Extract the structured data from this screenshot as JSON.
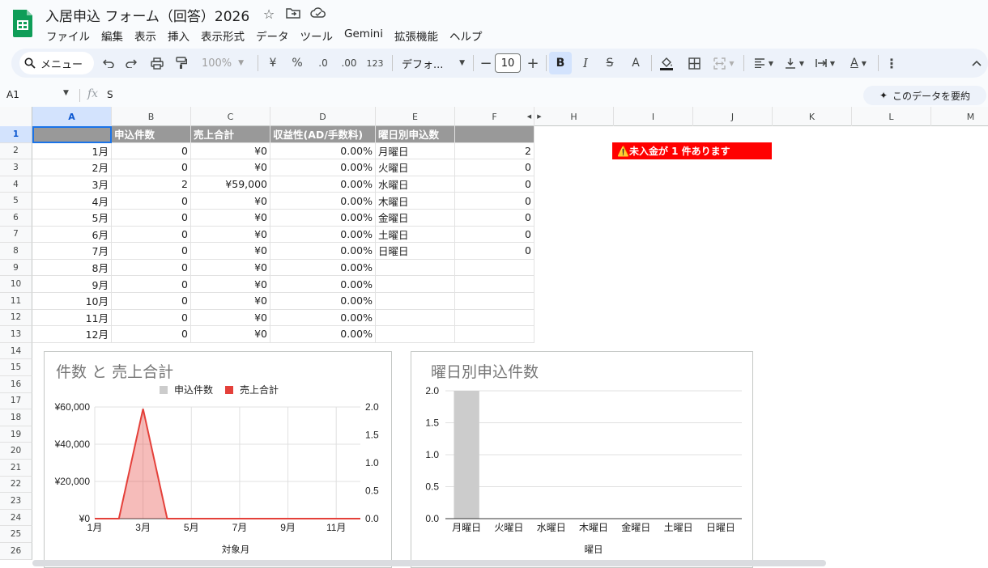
{
  "app": {
    "title": "入居申込 フォーム（回答）2026",
    "menus": [
      "ファイル",
      "編集",
      "表示",
      "挿入",
      "表示形式",
      "データ",
      "ツール",
      "Gemini",
      "拡張機能",
      "ヘルプ"
    ]
  },
  "toolbar": {
    "search_label": "メニュー",
    "zoom": "100%",
    "currency": "¥",
    "percent": "%",
    "decimal_decrease": ".0",
    "decimal_increase": ".00",
    "number_format": "123",
    "font_name": "デフォ...",
    "font_size": "10",
    "bold": "B",
    "italic": "I",
    "strike": "S",
    "text_color": "A",
    "text_color2": "A"
  },
  "formula_bar": {
    "cell_ref": "A1",
    "value": "S",
    "summarize_label": "このデータを要約"
  },
  "columns": [
    "A",
    "B",
    "C",
    "D",
    "E",
    "F",
    "H",
    "I",
    "J",
    "K",
    "L",
    "M"
  ],
  "rows": [
    "1",
    "2",
    "3",
    "4",
    "5",
    "6",
    "7",
    "8",
    "9",
    "10",
    "11",
    "12",
    "13",
    "14",
    "15",
    "16",
    "17",
    "18",
    "19",
    "20",
    "21",
    "22",
    "23",
    "24",
    "25",
    "26"
  ],
  "table": {
    "headers": [
      "",
      "申込件数",
      "売上合計",
      "収益性(AD/手数料)",
      "曜日別申込数",
      ""
    ],
    "rows": [
      [
        "1月",
        "0",
        "¥0",
        "0.00%",
        "月曜日",
        "2"
      ],
      [
        "2月",
        "0",
        "¥0",
        "0.00%",
        "火曜日",
        "0"
      ],
      [
        "3月",
        "2",
        "¥59,000",
        "0.00%",
        "水曜日",
        "0"
      ],
      [
        "4月",
        "0",
        "¥0",
        "0.00%",
        "木曜日",
        "0"
      ],
      [
        "5月",
        "0",
        "¥0",
        "0.00%",
        "金曜日",
        "0"
      ],
      [
        "6月",
        "0",
        "¥0",
        "0.00%",
        "土曜日",
        "0"
      ],
      [
        "7月",
        "0",
        "¥0",
        "0.00%",
        "日曜日",
        "0"
      ],
      [
        "8月",
        "0",
        "¥0",
        "0.00%",
        "",
        ""
      ],
      [
        "9月",
        "0",
        "¥0",
        "0.00%",
        "",
        ""
      ],
      [
        "10月",
        "0",
        "¥0",
        "0.00%",
        "",
        ""
      ],
      [
        "11月",
        "0",
        "¥0",
        "0.00%",
        "",
        ""
      ],
      [
        "12月",
        "0",
        "¥0",
        "0.00%",
        "",
        ""
      ]
    ]
  },
  "alert": {
    "text": "⚠️未入金が 1 件あります",
    "color": "#ff0000"
  },
  "chart_data": [
    {
      "type": "area",
      "title": "件数 と 売上合計",
      "xlabel": "対象月",
      "categories": [
        "1月",
        "2月",
        "3月",
        "4月",
        "5月",
        "6月",
        "7月",
        "8月",
        "9月",
        "10月",
        "11月",
        "12月"
      ],
      "x_tick_labels": [
        "1月",
        "3月",
        "5月",
        "7月",
        "9月",
        "11月"
      ],
      "series": [
        {
          "name": "申込件数",
          "axis": "right",
          "color": "#cccccc",
          "values": [
            0,
            0,
            2,
            0,
            0,
            0,
            0,
            0,
            0,
            0,
            0,
            0
          ]
        },
        {
          "name": "売上合計",
          "axis": "left",
          "color": "#e4403a",
          "values": [
            0,
            0,
            59000,
            0,
            0,
            0,
            0,
            0,
            0,
            0,
            0,
            0
          ]
        }
      ],
      "y_left_ticks": [
        "¥0",
        "¥20,000",
        "¥40,000",
        "¥60,000"
      ],
      "y_left_lim": [
        0,
        60000
      ],
      "y_right_ticks": [
        "0.0",
        "0.5",
        "1.0",
        "1.5",
        "2.0"
      ],
      "y_right_lim": [
        0,
        2
      ],
      "legend": "top",
      "grid": true
    },
    {
      "type": "bar",
      "title": "曜日別申込件数",
      "xlabel": "曜日",
      "categories": [
        "月曜日",
        "火曜日",
        "水曜日",
        "木曜日",
        "金曜日",
        "土曜日",
        "日曜日"
      ],
      "values": [
        2,
        0,
        0,
        0,
        0,
        0,
        0
      ],
      "color": "#cccccc",
      "y_ticks": [
        "0.0",
        "0.5",
        "1.0",
        "1.5",
        "2.0"
      ],
      "ylim": [
        0,
        2
      ],
      "grid": true
    }
  ]
}
